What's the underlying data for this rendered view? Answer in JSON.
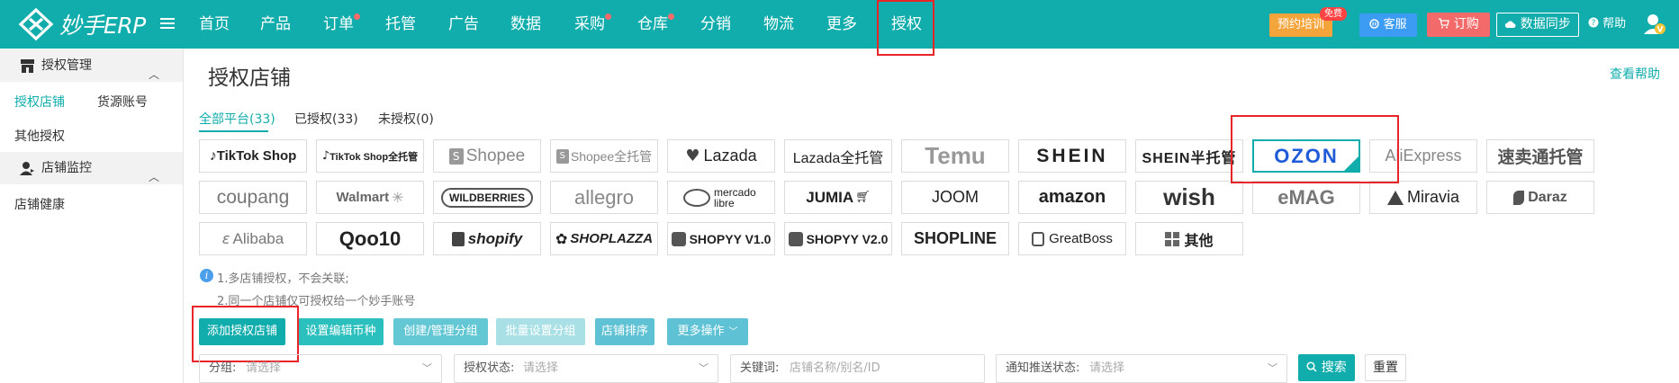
{
  "app": {
    "name": "妙手ERP"
  },
  "nav": {
    "items": [
      {
        "label": "首页",
        "dot": false
      },
      {
        "label": "产品",
        "dot": false
      },
      {
        "label": "订单",
        "dot": true
      },
      {
        "label": "托管",
        "dot": false
      },
      {
        "label": "广告",
        "dot": false
      },
      {
        "label": "数据",
        "dot": false
      },
      {
        "label": "采购",
        "dot": true
      },
      {
        "label": "仓库",
        "dot": true
      },
      {
        "label": "分销",
        "dot": false
      },
      {
        "label": "物流",
        "dot": false
      },
      {
        "label": "更多",
        "dot": false
      },
      {
        "label": "授权",
        "dot": false
      }
    ],
    "active": "授权",
    "training": "预约培训",
    "training_badge": "免费",
    "service": "客服",
    "order": "订购",
    "sync": "数据同步",
    "help": "帮助"
  },
  "sidebar": {
    "groups": [
      {
        "label": "授权管理",
        "icon": "store-icon"
      },
      {
        "label": "店铺监控",
        "icon": "user-monitor-icon"
      }
    ],
    "links": {
      "auth_stores": "授权店铺",
      "source_accounts": "货源账号",
      "other_auth": "其他授权",
      "store_health": "店铺健康"
    }
  },
  "main": {
    "title": "授权店铺",
    "view_help": "查看帮助",
    "tabs": [
      "全部平台(33)",
      "已授权(33)",
      "未授权(0)"
    ],
    "platforms": [
      "TikTok Shop",
      "TikTok Shop全托管",
      "Shopee",
      "Shopee全托管",
      "Lazada",
      "Lazada全托管",
      "Temu",
      "SHEIN",
      "SHEIN半托管",
      "OZON",
      "AliExpress",
      "速卖通托管",
      "coupang",
      "Walmart",
      "WILDBERRIES",
      "allegro",
      "mercado libre",
      "JUMIA",
      "JOOM",
      "amazon",
      "wish",
      "eMAG",
      "Miravia",
      "Daraz",
      "Alibaba",
      "Qoo10",
      "shopify",
      "SHOPLAZZA",
      "SHOPYY V1.0",
      "SHOPYY V2.0",
      "SHOPLINE",
      "GreatBoss",
      "其他"
    ],
    "selected_platform": "OZON",
    "notes": [
      "1.多店铺授权，不会关联;",
      "2.同一个店铺仅可授权给一个妙手账号"
    ],
    "actions": [
      "添加授权店铺",
      "设置编辑币种",
      "创建/管理分组",
      "批量设置分组",
      "店铺排序",
      "更多操作"
    ],
    "filters": {
      "group_label": "分组:",
      "group_placeholder": "请选择",
      "status_label": "授权状态:",
      "status_placeholder": "请选择",
      "keyword_label": "关键词:",
      "keyword_placeholder": "店铺名称/别名/ID",
      "notify_label": "通知推送状态:",
      "notify_placeholder": "请选择"
    },
    "search": "搜索",
    "reset": "重置"
  },
  "colors": {
    "brand": "#11adac",
    "highlight": "#e8262a"
  }
}
